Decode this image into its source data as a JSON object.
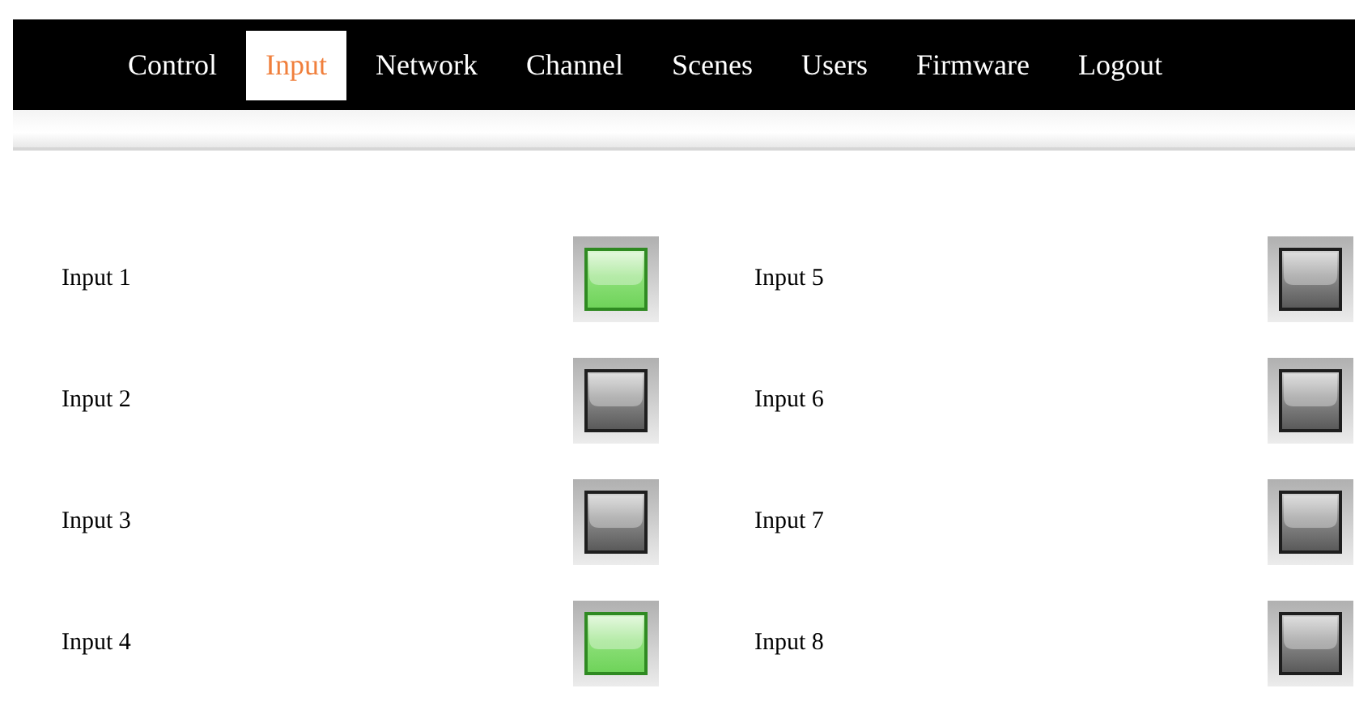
{
  "tabs": [
    {
      "label": "Control",
      "selected": false
    },
    {
      "label": "Input",
      "selected": true
    },
    {
      "label": "Network",
      "selected": false
    },
    {
      "label": "Channel",
      "selected": false
    },
    {
      "label": "Scenes",
      "selected": false
    },
    {
      "label": "Users",
      "selected": false
    },
    {
      "label": "Firmware",
      "selected": false
    },
    {
      "label": "Logout",
      "selected": false
    }
  ],
  "inputs": [
    {
      "label": "Input 1",
      "on": true
    },
    {
      "label": "Input 2",
      "on": false
    },
    {
      "label": "Input 3",
      "on": false
    },
    {
      "label": "Input 4",
      "on": true
    },
    {
      "label": "Input 5",
      "on": false
    },
    {
      "label": "Input 6",
      "on": false
    },
    {
      "label": "Input 7",
      "on": false
    },
    {
      "label": "Input 8",
      "on": false
    }
  ]
}
